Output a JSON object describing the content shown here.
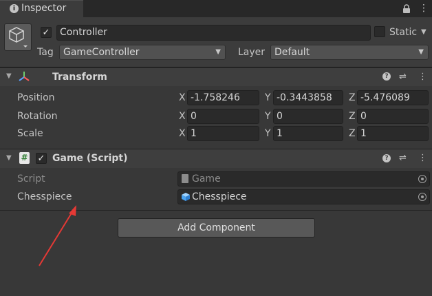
{
  "tab": {
    "title": "Inspector"
  },
  "header": {
    "object_name": "Controller",
    "static_label": "Static",
    "tag_label": "Tag",
    "tag_value": "GameController",
    "layer_label": "Layer",
    "layer_value": "Default"
  },
  "transform": {
    "title": "Transform",
    "rows": [
      {
        "label": "Position",
        "x": "-1.758246",
        "y": "-0.3443858",
        "z": "-5.476089"
      },
      {
        "label": "Rotation",
        "x": "0",
        "y": "0",
        "z": "0"
      },
      {
        "label": "Scale",
        "x": "1",
        "y": "1",
        "z": "1"
      }
    ],
    "axes": {
      "x": "X",
      "y": "Y",
      "z": "Z"
    }
  },
  "game_script": {
    "title": "Game (Script)",
    "script_label": "Script",
    "script_value": "Game",
    "chesspiece_label": "Chesspiece",
    "chesspiece_value": "Chesspiece"
  },
  "add_component_label": "Add Component",
  "annotation": {
    "arrow_color": "#e53935"
  }
}
